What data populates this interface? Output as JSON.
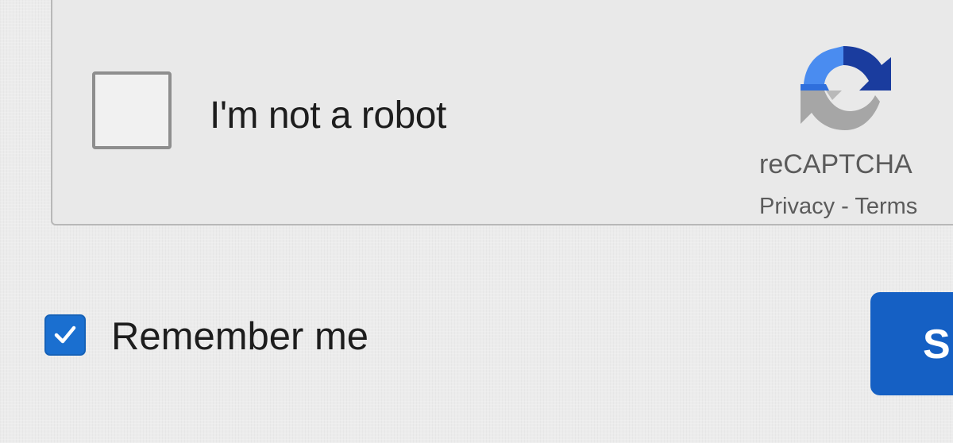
{
  "captcha": {
    "checkbox_checked": false,
    "label": "I'm not a robot",
    "brand": "reCAPTCHA",
    "privacy_link": "Privacy",
    "separator": " - ",
    "terms_link": "Terms",
    "logo_icon": "recaptcha-logo-icon",
    "colors": {
      "logo_blue_light": "#4a8cf0",
      "logo_blue_dark": "#1a3c9e",
      "logo_gray": "#a6a6a6"
    }
  },
  "remember": {
    "checked": true,
    "label": "Remember me",
    "check_icon": "checkmark-icon",
    "color": "#1a6fd0"
  },
  "submit": {
    "label_visible": "S",
    "color": "#1560c4"
  }
}
